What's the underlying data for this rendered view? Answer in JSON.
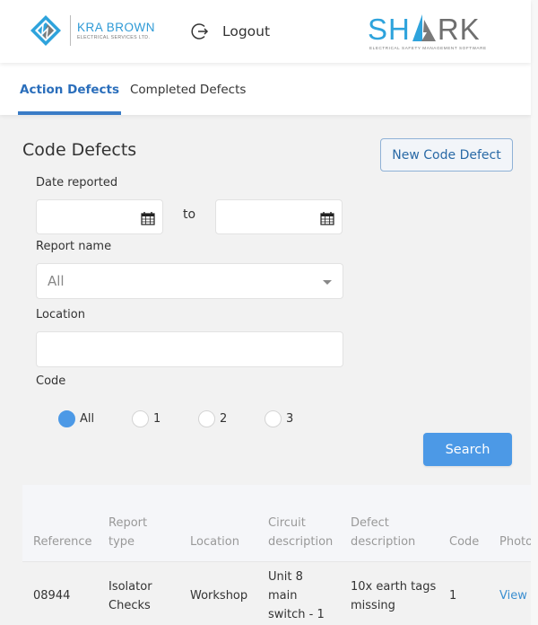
{
  "header": {
    "company_logo": {
      "name": "KRA BROWN",
      "subtitle": "ELECTRICAL SERVICES LTD."
    },
    "logout_label": "Logout",
    "product_logo": {
      "name_blue": "SH",
      "name_grey": "RK",
      "subtitle": "ELECTRICAL SAFETY MANAGEMENT SOFTWARE"
    },
    "brand_colors": {
      "blue": "#2ea3dc",
      "grey": "#6f6f6f"
    }
  },
  "tabs": [
    {
      "label": "Action Defects",
      "active": true
    },
    {
      "label": "Completed Defects",
      "active": false
    }
  ],
  "main": {
    "title": "Code Defects",
    "new_button_label": "New Code Defect",
    "filters": {
      "date_label": "Date reported",
      "date_from": "",
      "date_to": "",
      "to_label": "to",
      "report_name_label": "Report name",
      "report_name_value": "All",
      "location_label": "Location",
      "location_value": "",
      "code_label": "Code",
      "code_options": [
        {
          "label": "All",
          "checked": true
        },
        {
          "label": "1",
          "checked": false
        },
        {
          "label": "2",
          "checked": false
        },
        {
          "label": "3",
          "checked": false
        }
      ],
      "search_label": "Search"
    },
    "accent_color": "#4c99e6"
  },
  "table": {
    "columns": [
      {
        "line1": "",
        "line2": "Reference"
      },
      {
        "line1": "Report",
        "line2": "type"
      },
      {
        "line1": "",
        "line2": "Location"
      },
      {
        "line1": "Circuit",
        "line2": "description"
      },
      {
        "line1": "Defect",
        "line2": "description"
      },
      {
        "line1": "",
        "line2": "Code"
      },
      {
        "line1": "",
        "line2": "Photo"
      }
    ],
    "rows": [
      {
        "reference": "08944",
        "report_type": "Isolator Checks",
        "location": "Workshop",
        "circuit_description": "Unit 8 main switch - 1",
        "defect_description": "10x earth tags missing",
        "code": "1",
        "photo": "View"
      }
    ]
  }
}
